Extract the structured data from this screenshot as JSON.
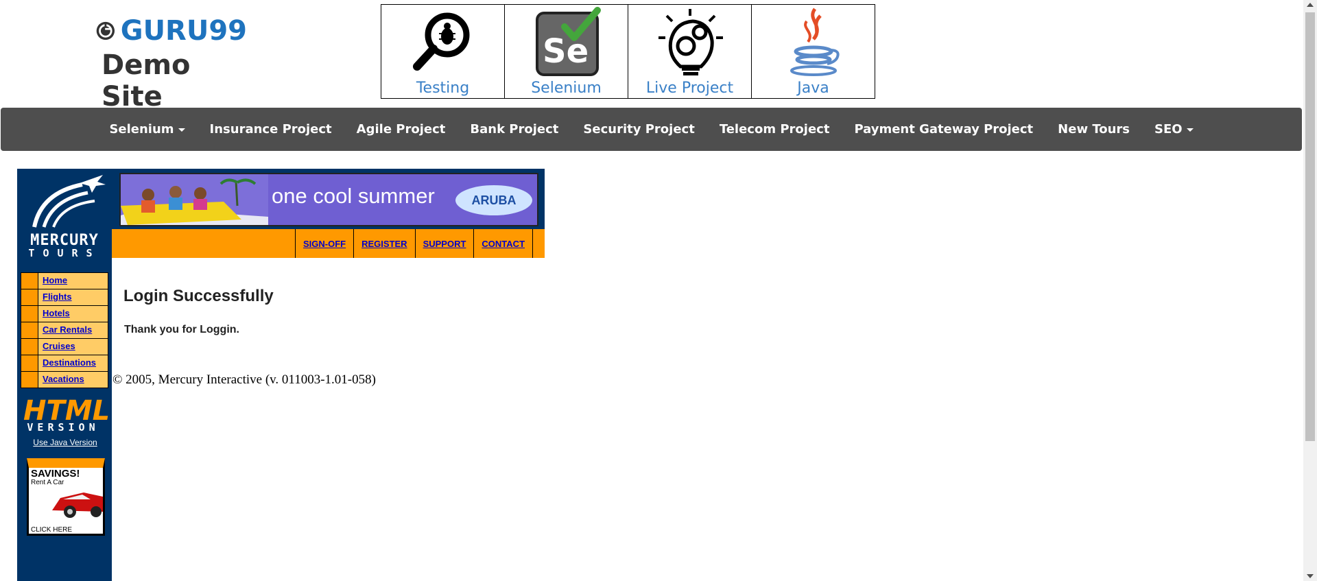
{
  "brand": {
    "name": "GURU99",
    "subtitle": "Demo Site"
  },
  "tiles": [
    {
      "label": "Testing",
      "icon": "bug-magnifier-icon"
    },
    {
      "label": "Selenium",
      "icon": "selenium-check-icon"
    },
    {
      "label": "Live Project",
      "icon": "gear-bulb-icon"
    },
    {
      "label": "Java",
      "icon": "java-cup-icon"
    }
  ],
  "navbar": {
    "items": [
      {
        "label": "Selenium",
        "dropdown": true
      },
      {
        "label": "Insurance Project"
      },
      {
        "label": "Agile Project"
      },
      {
        "label": "Bank Project"
      },
      {
        "label": "Security Project"
      },
      {
        "label": "Telecom Project"
      },
      {
        "label": "Payment Gateway Project"
      },
      {
        "label": "New Tours"
      },
      {
        "label": "SEO",
        "dropdown": true
      }
    ]
  },
  "mercury": {
    "logo_word": "MERCURY",
    "logo_sub": "TOURS",
    "side_menu": [
      "Home",
      "Flights",
      "Hotels",
      "Car Rentals",
      "Cruises",
      "Destinations",
      "Vacations"
    ],
    "html_version": {
      "word": "HTML",
      "sub": "VERSION"
    },
    "java_link": "Use Java Version",
    "savings_ad": {
      "title": "SAVINGS!",
      "sub": "Rent A Car",
      "click": "CLICK HERE"
    },
    "banner": {
      "text": "one cool summer",
      "brand": "ARUBA"
    },
    "top_nav": [
      "SIGN-OFF",
      "REGISTER",
      "SUPPORT",
      "CONTACT"
    ]
  },
  "content": {
    "title": "Login Successfully",
    "message": "Thank you for Loggin."
  },
  "footer": {
    "copyright": "© 2005, Mercury Interactive (v. 011003-1.01-058)"
  },
  "colors": {
    "brand_blue": "#1e73be",
    "navbar_bg": "#4e4e4e",
    "mercury_navy": "#003366",
    "mercury_orange": "#ff9900",
    "menu_yellow": "#ffcc66",
    "link_blue": "#0000cc"
  }
}
